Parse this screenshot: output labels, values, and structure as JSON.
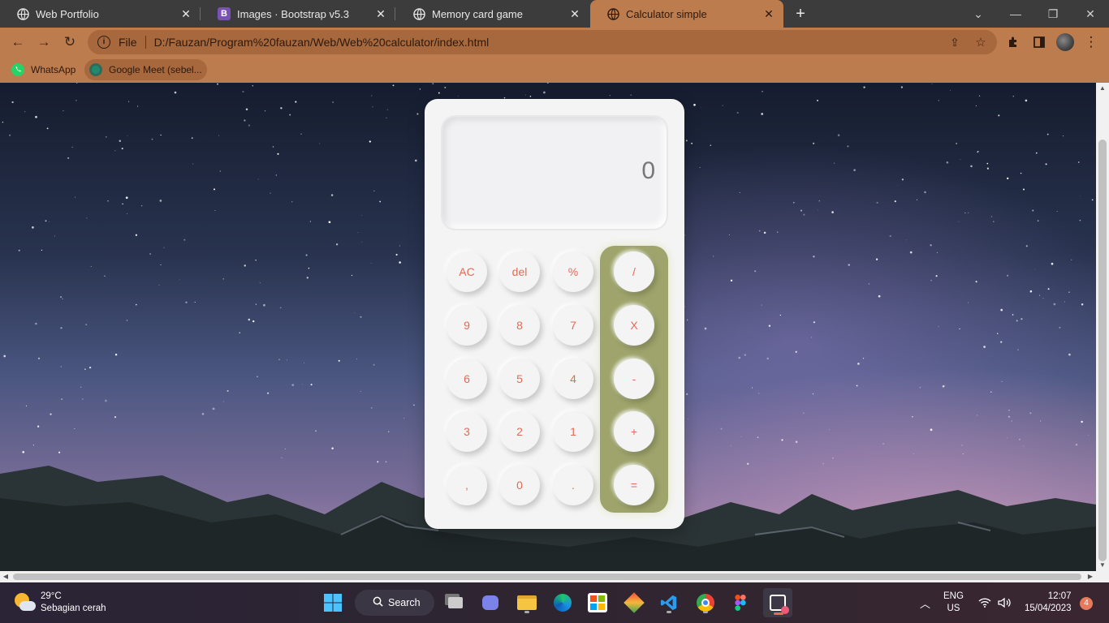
{
  "browser": {
    "tabs": [
      {
        "title": "Web Portfolio",
        "icon": "globe-icon",
        "active": false
      },
      {
        "title": "Images · Bootstrap v5.3",
        "icon": "bootstrap-icon",
        "active": false
      },
      {
        "title": "Memory card game",
        "icon": "globe-icon",
        "active": false
      },
      {
        "title": "Calculator simple",
        "icon": "globe-icon",
        "active": true
      }
    ],
    "address": {
      "scheme": "File",
      "url": "D:/Fauzan/Program%20fauzan/Web/Web%20calculator/index.html"
    },
    "bookmarks": [
      {
        "label": "WhatsApp",
        "icon": "whatsapp-icon"
      },
      {
        "label": "Google Meet (sebel...",
        "icon": "google-meet-icon"
      }
    ],
    "colors": {
      "chrome": "#bd7c4e",
      "omnibox": "#a7683d"
    }
  },
  "calculator": {
    "display": "0",
    "keys": {
      "row1": [
        "AC",
        "del",
        "%"
      ],
      "row2": [
        "9",
        "8",
        "7"
      ],
      "row3": [
        "6",
        "5",
        "4"
      ],
      "row4": [
        "3",
        "2",
        "1"
      ],
      "row5": [
        ",",
        "0",
        "."
      ]
    },
    "operators": [
      "/",
      "X",
      "-",
      "+",
      "="
    ],
    "colors": {
      "key_text": "#e26b56",
      "operator_panel": "#9ea46b",
      "body": "#f4f4f4"
    }
  },
  "taskbar": {
    "weather": {
      "temp": "29°C",
      "desc": "Sebagian cerah"
    },
    "search_label": "Search",
    "lang_top": "ENG",
    "lang_bottom": "US",
    "time": "12:07",
    "date": "15/04/2023",
    "notifications": "4"
  }
}
